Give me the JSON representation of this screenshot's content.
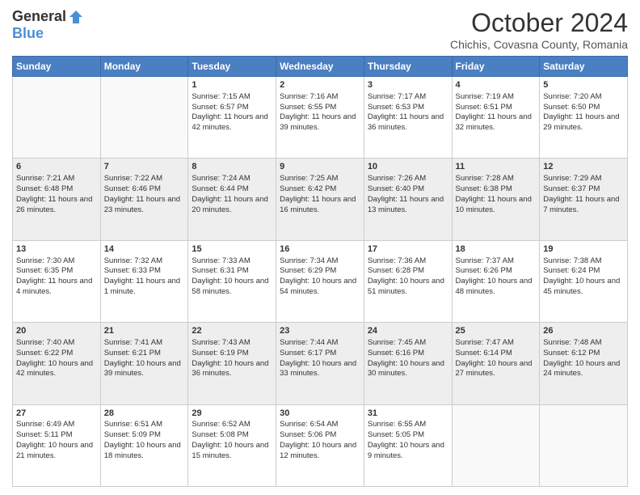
{
  "header": {
    "logo_general": "General",
    "logo_blue": "Blue",
    "month_title": "October 2024",
    "subtitle": "Chichis, Covasna County, Romania"
  },
  "days_of_week": [
    "Sunday",
    "Monday",
    "Tuesday",
    "Wednesday",
    "Thursday",
    "Friday",
    "Saturday"
  ],
  "weeks": [
    [
      {
        "day": "",
        "empty": true
      },
      {
        "day": "",
        "empty": true
      },
      {
        "day": "1",
        "sunrise": "Sunrise: 7:15 AM",
        "sunset": "Sunset: 6:57 PM",
        "daylight": "Daylight: 11 hours and 42 minutes."
      },
      {
        "day": "2",
        "sunrise": "Sunrise: 7:16 AM",
        "sunset": "Sunset: 6:55 PM",
        "daylight": "Daylight: 11 hours and 39 minutes."
      },
      {
        "day": "3",
        "sunrise": "Sunrise: 7:17 AM",
        "sunset": "Sunset: 6:53 PM",
        "daylight": "Daylight: 11 hours and 36 minutes."
      },
      {
        "day": "4",
        "sunrise": "Sunrise: 7:19 AM",
        "sunset": "Sunset: 6:51 PM",
        "daylight": "Daylight: 11 hours and 32 minutes."
      },
      {
        "day": "5",
        "sunrise": "Sunrise: 7:20 AM",
        "sunset": "Sunset: 6:50 PM",
        "daylight": "Daylight: 11 hours and 29 minutes."
      }
    ],
    [
      {
        "day": "6",
        "sunrise": "Sunrise: 7:21 AM",
        "sunset": "Sunset: 6:48 PM",
        "daylight": "Daylight: 11 hours and 26 minutes."
      },
      {
        "day": "7",
        "sunrise": "Sunrise: 7:22 AM",
        "sunset": "Sunset: 6:46 PM",
        "daylight": "Daylight: 11 hours and 23 minutes."
      },
      {
        "day": "8",
        "sunrise": "Sunrise: 7:24 AM",
        "sunset": "Sunset: 6:44 PM",
        "daylight": "Daylight: 11 hours and 20 minutes."
      },
      {
        "day": "9",
        "sunrise": "Sunrise: 7:25 AM",
        "sunset": "Sunset: 6:42 PM",
        "daylight": "Daylight: 11 hours and 16 minutes."
      },
      {
        "day": "10",
        "sunrise": "Sunrise: 7:26 AM",
        "sunset": "Sunset: 6:40 PM",
        "daylight": "Daylight: 11 hours and 13 minutes."
      },
      {
        "day": "11",
        "sunrise": "Sunrise: 7:28 AM",
        "sunset": "Sunset: 6:38 PM",
        "daylight": "Daylight: 11 hours and 10 minutes."
      },
      {
        "day": "12",
        "sunrise": "Sunrise: 7:29 AM",
        "sunset": "Sunset: 6:37 PM",
        "daylight": "Daylight: 11 hours and 7 minutes."
      }
    ],
    [
      {
        "day": "13",
        "sunrise": "Sunrise: 7:30 AM",
        "sunset": "Sunset: 6:35 PM",
        "daylight": "Daylight: 11 hours and 4 minutes."
      },
      {
        "day": "14",
        "sunrise": "Sunrise: 7:32 AM",
        "sunset": "Sunset: 6:33 PM",
        "daylight": "Daylight: 11 hours and 1 minute."
      },
      {
        "day": "15",
        "sunrise": "Sunrise: 7:33 AM",
        "sunset": "Sunset: 6:31 PM",
        "daylight": "Daylight: 10 hours and 58 minutes."
      },
      {
        "day": "16",
        "sunrise": "Sunrise: 7:34 AM",
        "sunset": "Sunset: 6:29 PM",
        "daylight": "Daylight: 10 hours and 54 minutes."
      },
      {
        "day": "17",
        "sunrise": "Sunrise: 7:36 AM",
        "sunset": "Sunset: 6:28 PM",
        "daylight": "Daylight: 10 hours and 51 minutes."
      },
      {
        "day": "18",
        "sunrise": "Sunrise: 7:37 AM",
        "sunset": "Sunset: 6:26 PM",
        "daylight": "Daylight: 10 hours and 48 minutes."
      },
      {
        "day": "19",
        "sunrise": "Sunrise: 7:38 AM",
        "sunset": "Sunset: 6:24 PM",
        "daylight": "Daylight: 10 hours and 45 minutes."
      }
    ],
    [
      {
        "day": "20",
        "sunrise": "Sunrise: 7:40 AM",
        "sunset": "Sunset: 6:22 PM",
        "daylight": "Daylight: 10 hours and 42 minutes."
      },
      {
        "day": "21",
        "sunrise": "Sunrise: 7:41 AM",
        "sunset": "Sunset: 6:21 PM",
        "daylight": "Daylight: 10 hours and 39 minutes."
      },
      {
        "day": "22",
        "sunrise": "Sunrise: 7:43 AM",
        "sunset": "Sunset: 6:19 PM",
        "daylight": "Daylight: 10 hours and 36 minutes."
      },
      {
        "day": "23",
        "sunrise": "Sunrise: 7:44 AM",
        "sunset": "Sunset: 6:17 PM",
        "daylight": "Daylight: 10 hours and 33 minutes."
      },
      {
        "day": "24",
        "sunrise": "Sunrise: 7:45 AM",
        "sunset": "Sunset: 6:16 PM",
        "daylight": "Daylight: 10 hours and 30 minutes."
      },
      {
        "day": "25",
        "sunrise": "Sunrise: 7:47 AM",
        "sunset": "Sunset: 6:14 PM",
        "daylight": "Daylight: 10 hours and 27 minutes."
      },
      {
        "day": "26",
        "sunrise": "Sunrise: 7:48 AM",
        "sunset": "Sunset: 6:12 PM",
        "daylight": "Daylight: 10 hours and 24 minutes."
      }
    ],
    [
      {
        "day": "27",
        "sunrise": "Sunrise: 6:49 AM",
        "sunset": "Sunset: 5:11 PM",
        "daylight": "Daylight: 10 hours and 21 minutes."
      },
      {
        "day": "28",
        "sunrise": "Sunrise: 6:51 AM",
        "sunset": "Sunset: 5:09 PM",
        "daylight": "Daylight: 10 hours and 18 minutes."
      },
      {
        "day": "29",
        "sunrise": "Sunrise: 6:52 AM",
        "sunset": "Sunset: 5:08 PM",
        "daylight": "Daylight: 10 hours and 15 minutes."
      },
      {
        "day": "30",
        "sunrise": "Sunrise: 6:54 AM",
        "sunset": "Sunset: 5:06 PM",
        "daylight": "Daylight: 10 hours and 12 minutes."
      },
      {
        "day": "31",
        "sunrise": "Sunrise: 6:55 AM",
        "sunset": "Sunset: 5:05 PM",
        "daylight": "Daylight: 10 hours and 9 minutes."
      },
      {
        "day": "",
        "empty": true
      },
      {
        "day": "",
        "empty": true
      }
    ]
  ]
}
